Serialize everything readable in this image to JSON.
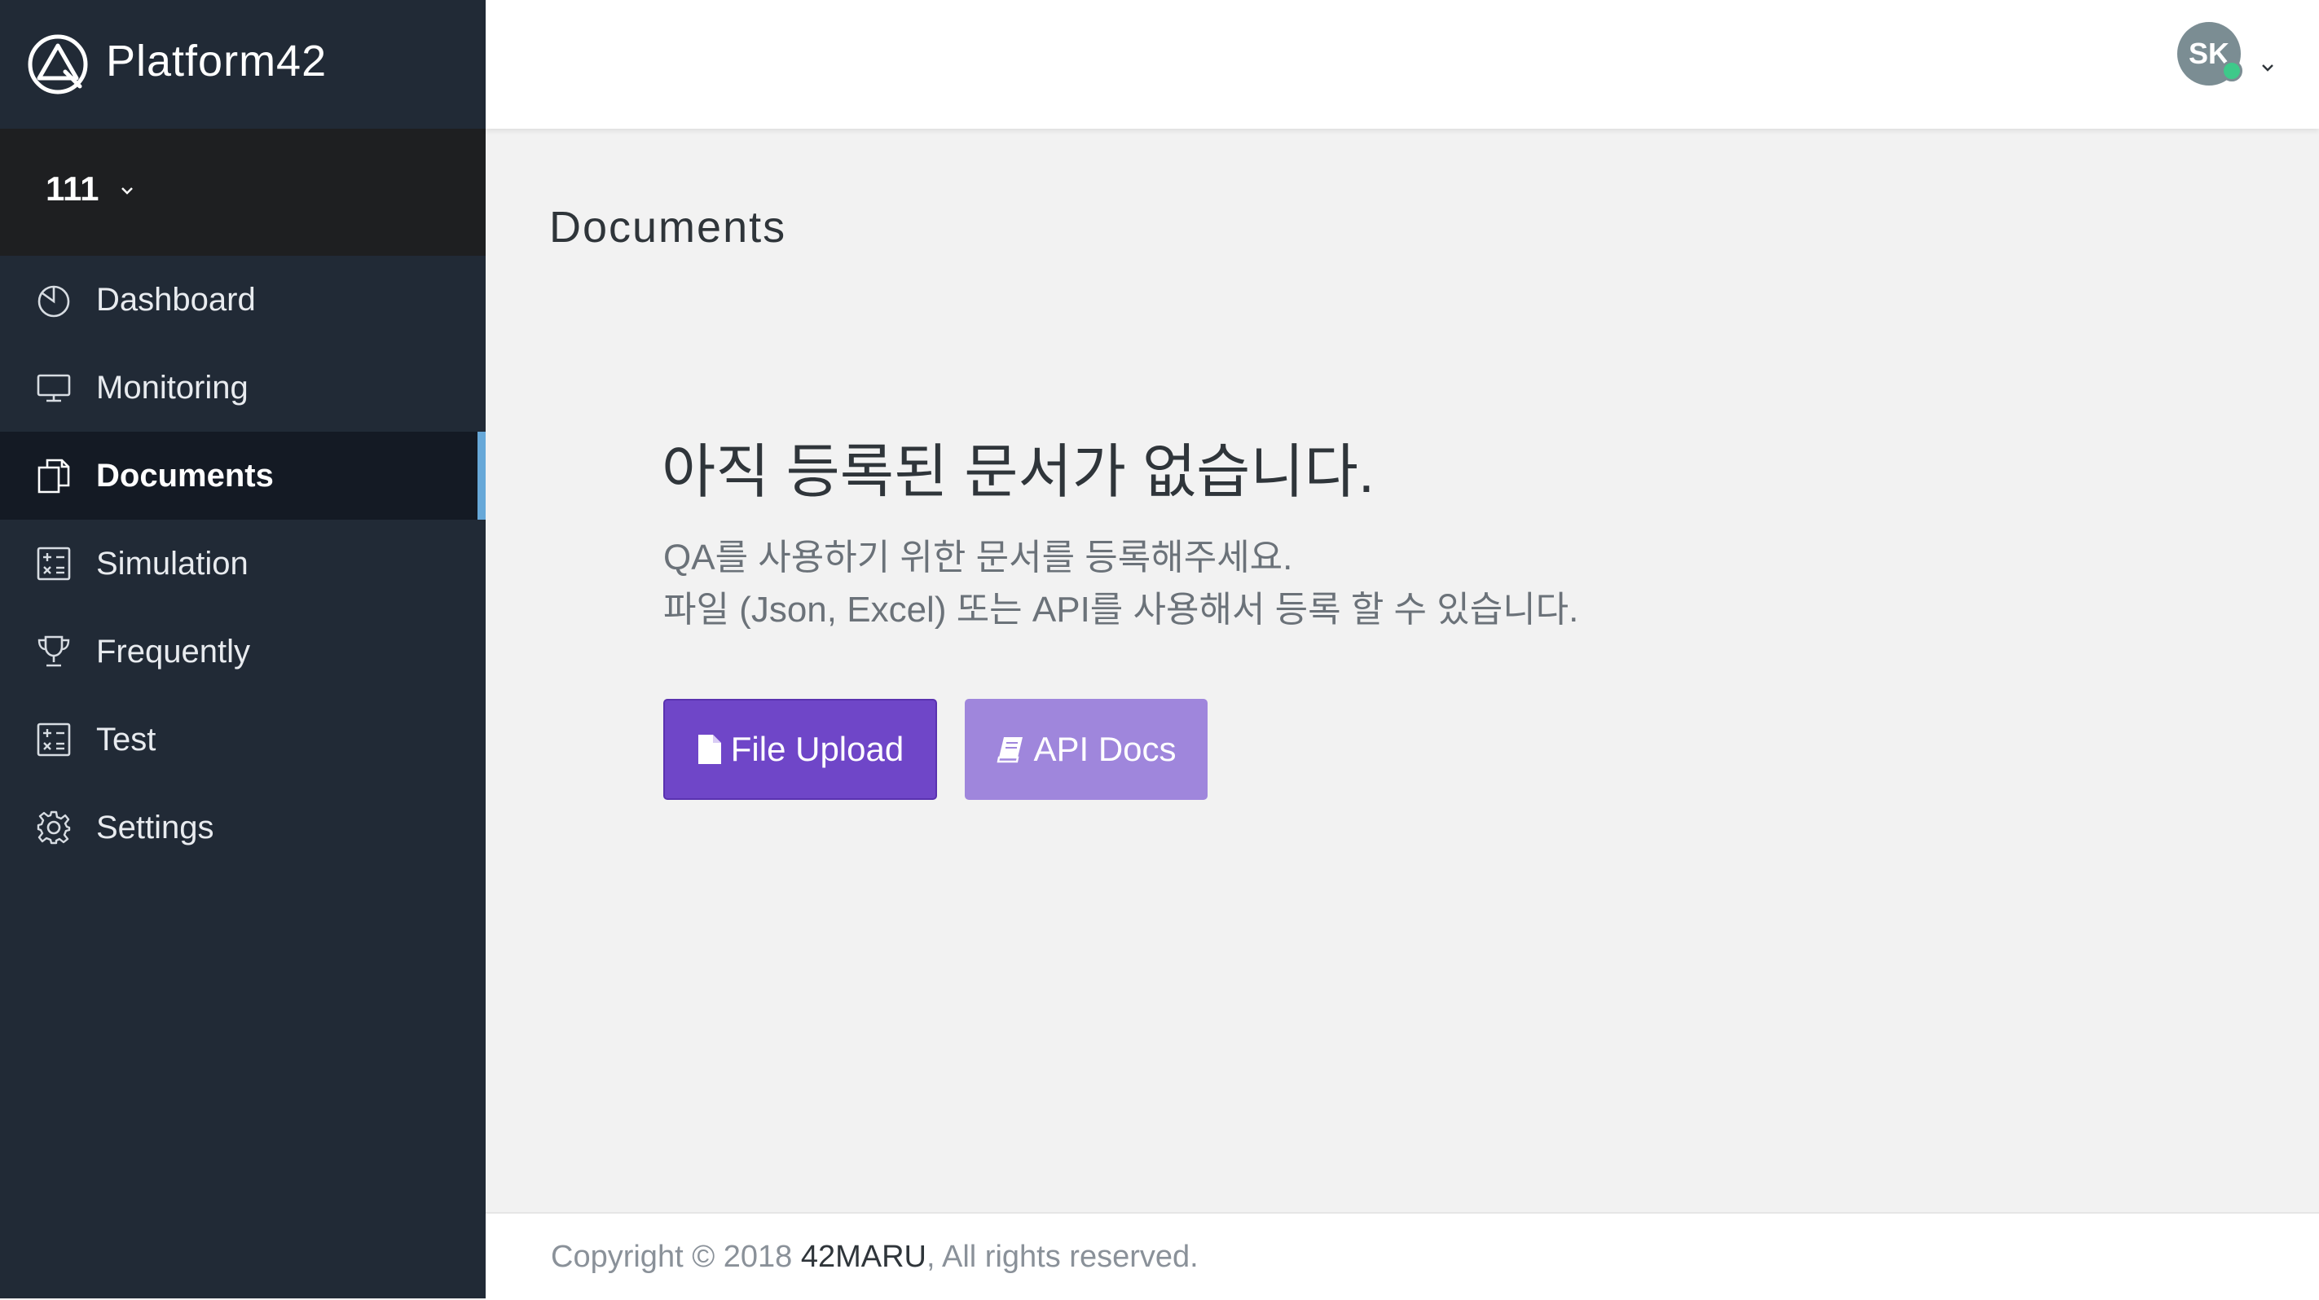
{
  "brand": {
    "name": "Platform42"
  },
  "project_selector": {
    "label": "111"
  },
  "sidebar": {
    "items": [
      {
        "label": "Dashboard",
        "icon": "pie-chart-icon",
        "active": false
      },
      {
        "label": "Monitoring",
        "icon": "monitor-icon",
        "active": false
      },
      {
        "label": "Documents",
        "icon": "documents-icon",
        "active": true
      },
      {
        "label": "Simulation",
        "icon": "calculator-icon",
        "active": false
      },
      {
        "label": "Frequently",
        "icon": "trophy-icon",
        "active": false
      },
      {
        "label": "Test",
        "icon": "calculator-icon",
        "active": false
      },
      {
        "label": "Settings",
        "icon": "gear-icon",
        "active": false
      }
    ]
  },
  "header": {
    "avatar_initials": "SK",
    "status": "online"
  },
  "main": {
    "page_title": "Documents",
    "empty_title": "아직 등록된 문서가 없습니다.",
    "empty_desc_line1": "QA를 사용하기 위한 문서를 등록해주세요.",
    "empty_desc_line2": "파일 (Json, Excel) 또는 API를 사용해서 등록 할 수 있습니다.",
    "buttons": {
      "upload_label": "File Upload",
      "api_label": "API Docs"
    }
  },
  "footer": {
    "prefix": "Copyright © 2018 ",
    "company": "42MARU",
    "suffix": ", All rights reserved."
  },
  "colors": {
    "sidebar_bg": "#212a36",
    "active_indicator": "#67a8d8",
    "primary_button": "#6f46c8",
    "secondary_button": "#9f86dc",
    "status_online": "#3ec98a"
  }
}
